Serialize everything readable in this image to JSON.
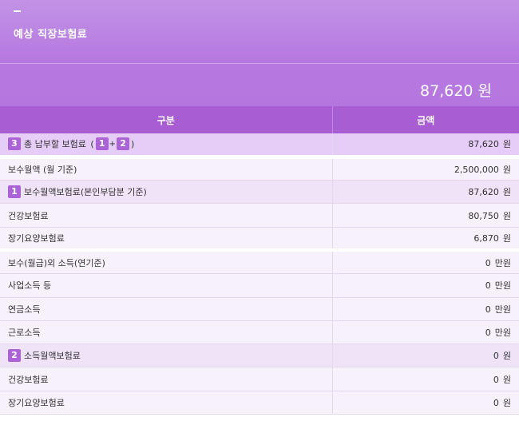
{
  "header": {
    "title": "예상 직장보험료",
    "total_value": "87,620",
    "total_unit": "원"
  },
  "table": {
    "columns": [
      "구분",
      "금액"
    ],
    "total_row": {
      "badge": "3",
      "label": "총 납부할 보험료",
      "formula_open": "(",
      "formula_a": "1",
      "formula_plus": "+",
      "formula_b": "2",
      "formula_close": ")",
      "amount": "87,620",
      "unit": "원"
    },
    "rows": [
      {
        "label": "보수월액 (월 기준)",
        "amount": "2,500,000",
        "unit": "원"
      },
      {
        "badge": "1",
        "label": "보수월액보험료(본인부담분 기준)",
        "amount": "87,620",
        "unit": "원"
      },
      {
        "label": "건강보험료",
        "amount": "80,750",
        "unit": "원"
      },
      {
        "label": "장기요양보험료",
        "amount": "6,870",
        "unit": "원"
      },
      {
        "label": "보수(월급)외 소득(연기준)",
        "amount": "0",
        "unit": "만원"
      },
      {
        "label": "사업소득 등",
        "amount": "0",
        "unit": "만원"
      },
      {
        "label": "연금소득",
        "amount": "0",
        "unit": "만원"
      },
      {
        "label": "근로소득",
        "amount": "0",
        "unit": "만원"
      },
      {
        "badge": "2",
        "label": "소득월액보험료",
        "amount": "0",
        "unit": "원"
      },
      {
        "label": "건강보험료",
        "amount": "0",
        "unit": "원"
      },
      {
        "label": "장기요양보험료",
        "amount": "0",
        "unit": "원"
      }
    ]
  }
}
